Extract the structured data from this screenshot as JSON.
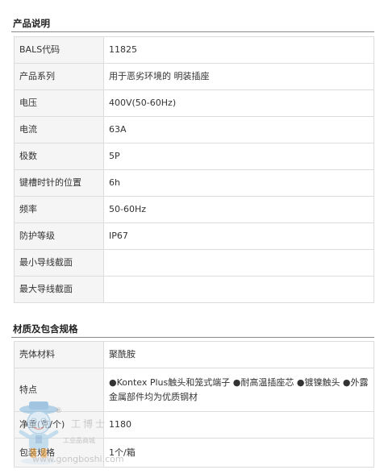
{
  "section1": {
    "title": "产品说明",
    "rows": [
      {
        "key": "BALS代码",
        "value": "11825"
      },
      {
        "key": "产品系列",
        "value": "用于恶劣环境的 明装插座"
      },
      {
        "key": "电压",
        "value": "400V(50-60Hz)"
      },
      {
        "key": "电流",
        "value": "63A"
      },
      {
        "key": "极数",
        "value": "5P"
      },
      {
        "key": "键槽时针的位置",
        "value": "6h"
      },
      {
        "key": "频率",
        "value": "50-60Hz"
      },
      {
        "key": "防护等级",
        "value": "IP67"
      },
      {
        "key": "最小导线截面",
        "value": ""
      },
      {
        "key": "最大导线截面",
        "value": ""
      }
    ]
  },
  "section2": {
    "title": "材质及包含规格",
    "rows": [
      {
        "key": "壳体材料",
        "value": "聚酰胺"
      },
      {
        "key": "特点",
        "value": "●Kontex Plus触头和笼式端子 ●耐高温插座芯 ●镀镍触头 ●外露金属部件均为优质钢材"
      },
      {
        "key": "净重(克/个)",
        "value": "1180"
      },
      {
        "key": "包装规格",
        "value": "1个/箱"
      }
    ]
  },
  "watermark": {
    "registered_mark": "®",
    "brand": "工博士",
    "subtitle": "工业品商城",
    "url": "www.gongboshi.com"
  }
}
